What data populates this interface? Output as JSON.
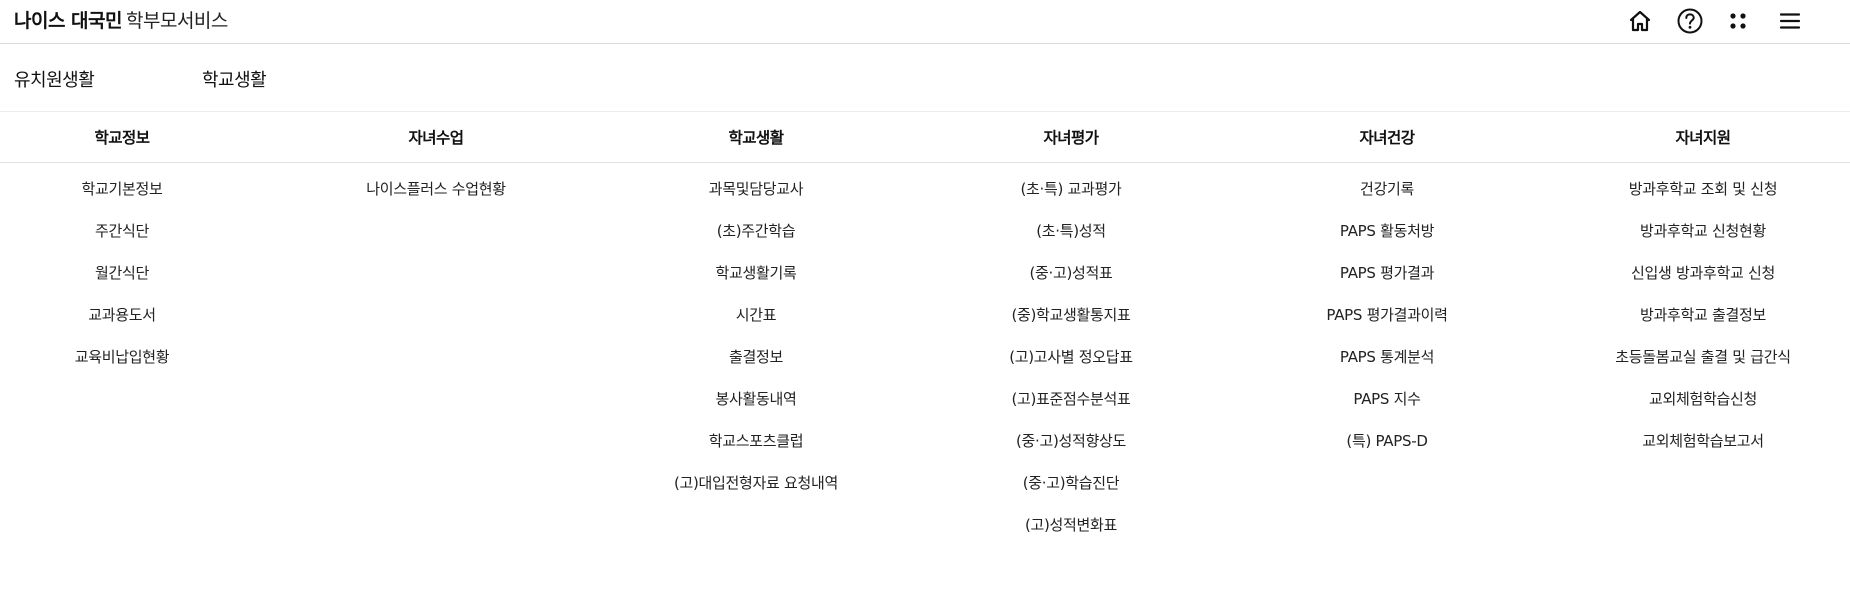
{
  "header": {
    "brand_strong": "나이스 대국민",
    "brand_light": "학부모서비스",
    "icons": [
      "home-icon",
      "help-icon",
      "apps-grid-icon",
      "hamburger-menu-icon"
    ]
  },
  "tabs": [
    {
      "label": "유치원생활"
    },
    {
      "label": "학교생활"
    }
  ],
  "menu": {
    "columns": [
      {
        "title": "학교정보",
        "items": [
          "학교기본정보",
          "주간식단",
          "월간식단",
          "교과용도서",
          "교육비납입현황"
        ]
      },
      {
        "title": "자녀수업",
        "items": [
          "나이스플러스 수업현황"
        ]
      },
      {
        "title": "학교생활",
        "items": [
          "과목및담당교사",
          "(초)주간학습",
          "학교생활기록",
          "시간표",
          "출결정보",
          "봉사활동내역",
          "학교스포츠클럽",
          "(고)대입전형자료 요청내역"
        ]
      },
      {
        "title": "자녀평가",
        "items": [
          "(초·특) 교과평가",
          "(초·특)성적",
          "(중·고)성적표",
          "(중)학교생활통지표",
          "(고)고사별 정오답표",
          "(고)표준점수분석표",
          "(중·고)성적향상도",
          "(중·고)학습진단",
          "(고)성적변화표"
        ]
      },
      {
        "title": "자녀건강",
        "items": [
          "건강기록",
          "PAPS 활동처방",
          "PAPS 평가결과",
          "PAPS 평가결과이력",
          "PAPS 통계분석",
          "PAPS 지수",
          "(특) PAPS-D"
        ]
      },
      {
        "title": "자녀지원",
        "items": [
          "방과후학교 조회 및 신청",
          "방과후학교 신청현황",
          "신입생 방과후학교 신청",
          "방과후학교 출결정보",
          "초등돌봄교실 출결 및 급간식",
          "교외체험학습신청",
          "교외체험학습보고서"
        ]
      }
    ]
  }
}
